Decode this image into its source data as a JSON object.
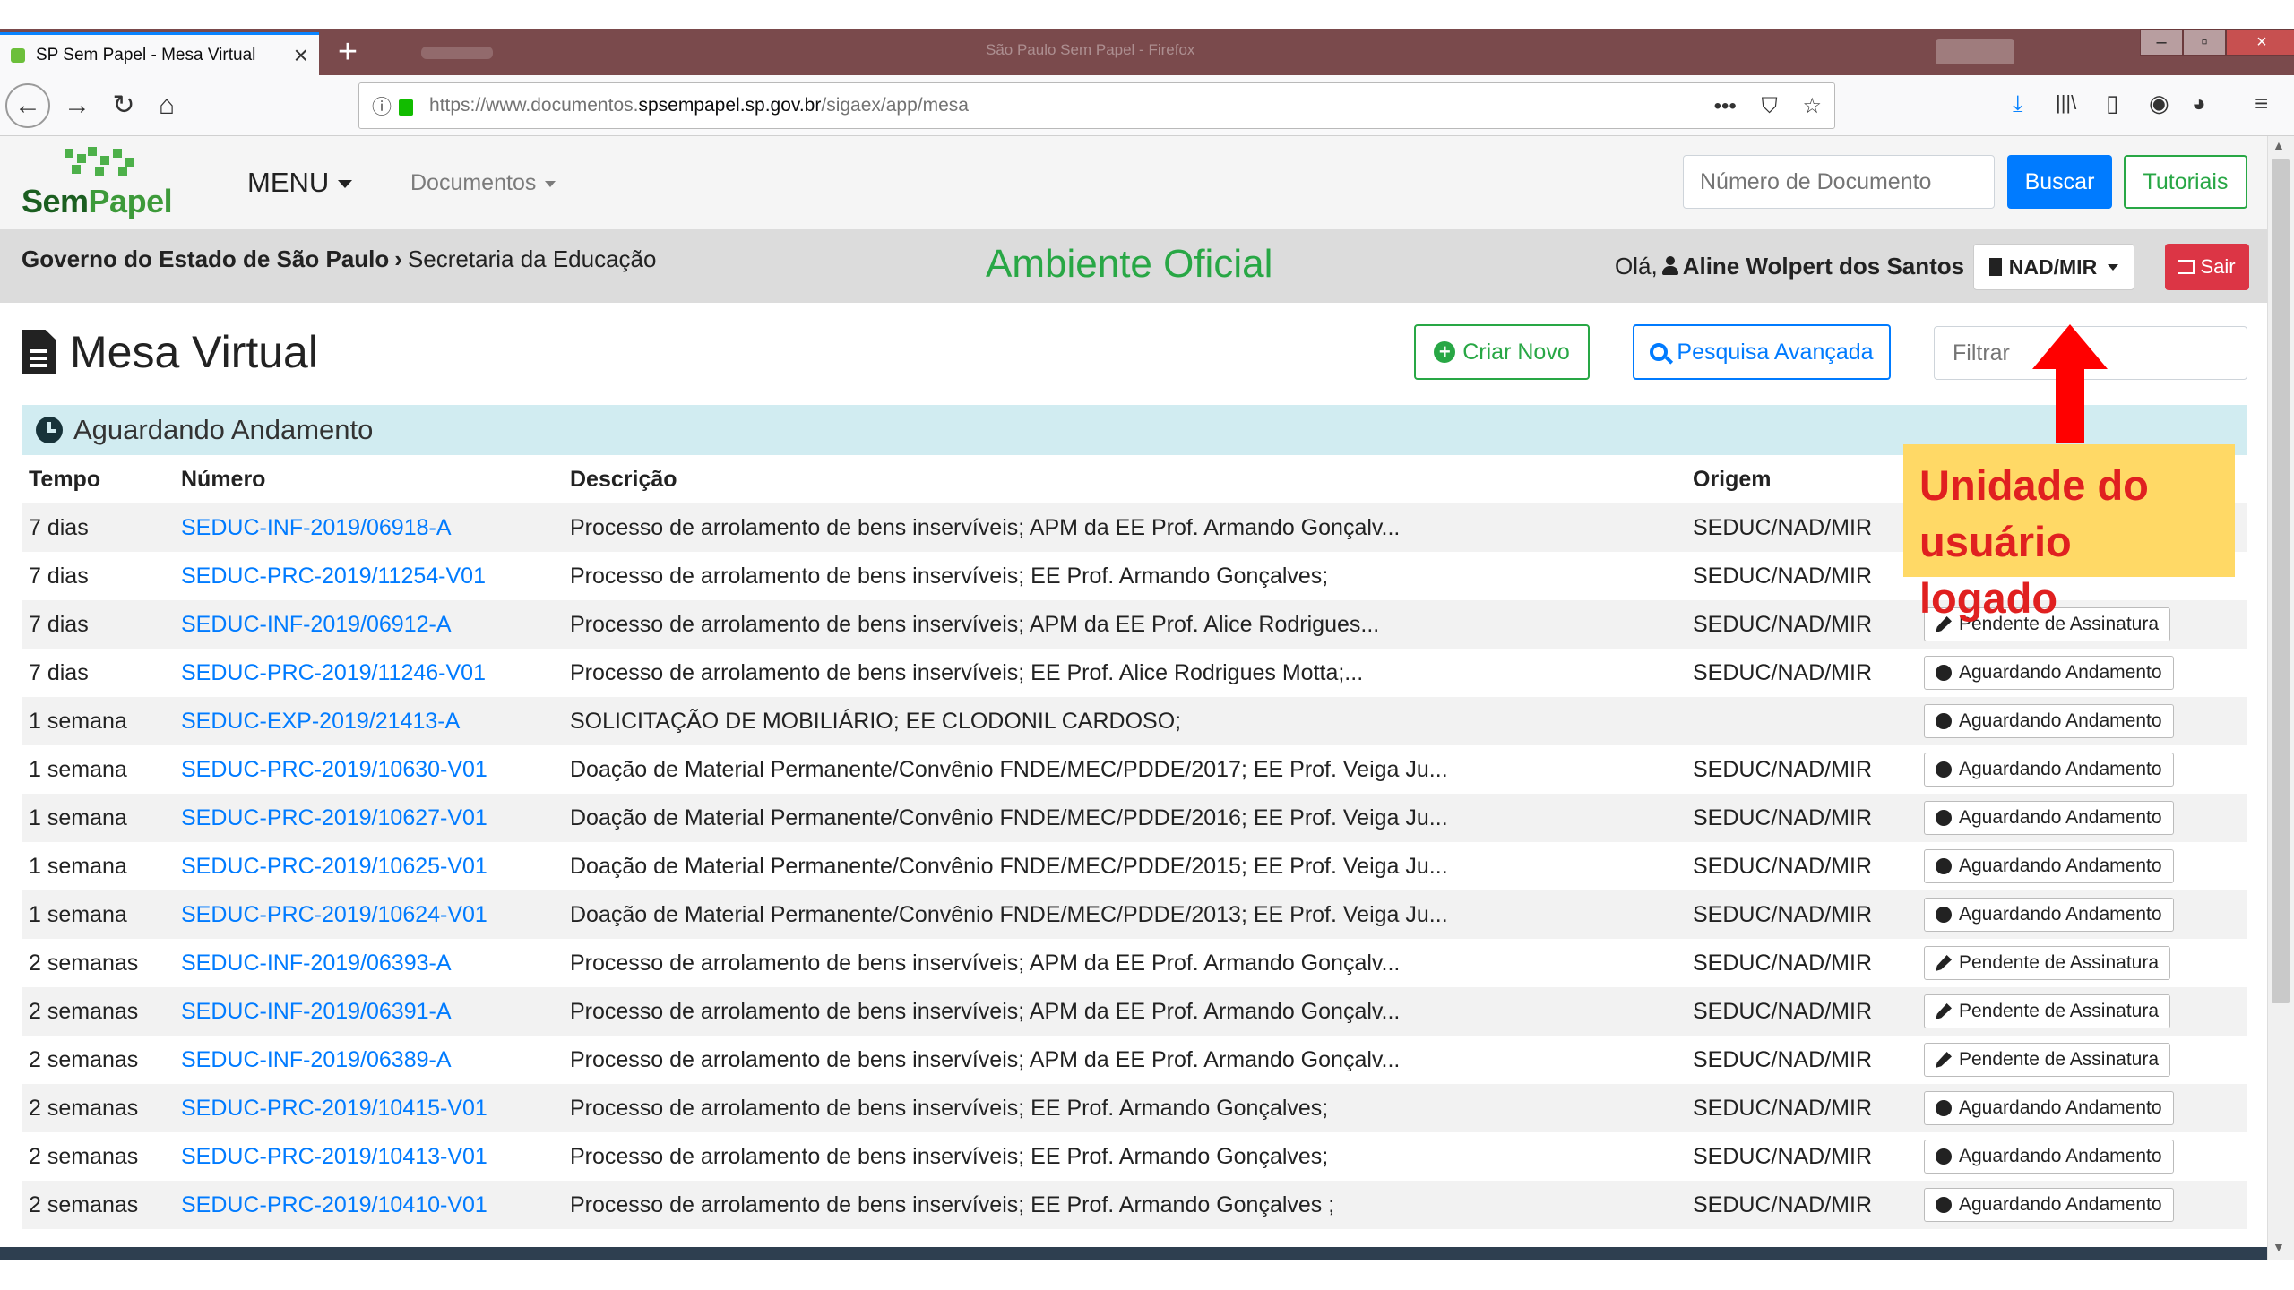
{
  "browser": {
    "tab_title": "SP Sem Papel - Mesa Virtual",
    "tab_close": "×",
    "new_tab": "+",
    "window_title": "São Paulo Sem Papel - Firefox",
    "url_plain_prefix": "https://www.documentos.",
    "url_domain": "spsempapel.sp.gov.br",
    "url_path": "/sigaex/app/mesa",
    "url_more": "•••",
    "nav": {
      "back": "←",
      "forward": "→",
      "reload": "↻",
      "home": "⌂"
    },
    "toolbar": {
      "download": "⤓",
      "library": "|||\\",
      "sidebar": "▯",
      "account": "◉",
      "menu": "≡"
    }
  },
  "header": {
    "logo": {
      "sem": "Sem",
      "papel": "Papel"
    },
    "menu_label": "MENU",
    "documents_label": "Documentos",
    "doc_number_placeholder": "Número de Documento",
    "search_button": "Buscar",
    "tutorials_button": "Tutoriais"
  },
  "statusbar": {
    "breadcrumb_root": "Governo do Estado de São Paulo",
    "breadcrumb_sep": "›",
    "breadcrumb_child": "Secretaria da Educação",
    "environment": "Ambiente Oficial",
    "greeting": "Olá,",
    "user_name": "Aline Wolpert dos Santos",
    "unit": "NAD/MIR",
    "logout": "Sair"
  },
  "main": {
    "page_title": "Mesa Virtual",
    "create_button": "Criar Novo",
    "advanced_search_button": "Pesquisa Avançada",
    "filter_placeholder": "Filtrar",
    "group_title": "Aguardando Andamento",
    "columns": {
      "time": "Tempo",
      "number": "Número",
      "description": "Descrição",
      "origin": "Origem"
    },
    "rows": [
      {
        "time": "7 dias",
        "number": "SEDUC-INF-2019/06918-A",
        "description": "Processo de arrolamento de bens inservíveis; APM da EE Prof. Armando Gonçalv...",
        "origin": "SEDUC/NAD/MIR",
        "status": "",
        "status_icon": ""
      },
      {
        "time": "7 dias",
        "number": "SEDUC-PRC-2019/11254-V01",
        "description": "Processo de arrolamento de bens inservíveis; EE Prof. Armando Gonçalves;",
        "origin": "SEDUC/NAD/MIR",
        "status": "",
        "status_icon": ""
      },
      {
        "time": "7 dias",
        "number": "SEDUC-INF-2019/06912-A",
        "description": "Processo de arrolamento de bens inservíveis; APM da EE Prof. Alice Rodrigues...",
        "origin": "SEDUC/NAD/MIR",
        "status": "Pendente de Assinatura",
        "status_icon": "pen-icon"
      },
      {
        "time": "7 dias",
        "number": "SEDUC-PRC-2019/11246-V01",
        "description": "Processo de arrolamento de bens inservíveis; EE Prof. Alice Rodrigues Motta;...",
        "origin": "SEDUC/NAD/MIR",
        "status": "Aguardando Andamento",
        "status_icon": "clock-icon"
      },
      {
        "time": "1 semana",
        "number": "SEDUC-EXP-2019/21413-A",
        "description": "SOLICITAÇÃO DE MOBILIÁRIO; EE CLODONIL CARDOSO;",
        "origin": "",
        "status": "Aguardando Andamento",
        "status_icon": "clock-icon"
      },
      {
        "time": "1 semana",
        "number": "SEDUC-PRC-2019/10630-V01",
        "description": "Doação de Material Permanente/Convênio FNDE/MEC/PDDE/2017; EE Prof. Veiga Ju...",
        "origin": "SEDUC/NAD/MIR",
        "status": "Aguardando Andamento",
        "status_icon": "clock-icon"
      },
      {
        "time": "1 semana",
        "number": "SEDUC-PRC-2019/10627-V01",
        "description": "Doação de Material Permanente/Convênio FNDE/MEC/PDDE/2016; EE Prof. Veiga Ju...",
        "origin": "SEDUC/NAD/MIR",
        "status": "Aguardando Andamento",
        "status_icon": "clock-icon"
      },
      {
        "time": "1 semana",
        "number": "SEDUC-PRC-2019/10625-V01",
        "description": "Doação de Material Permanente/Convênio FNDE/MEC/PDDE/2015; EE Prof. Veiga Ju...",
        "origin": "SEDUC/NAD/MIR",
        "status": "Aguardando Andamento",
        "status_icon": "clock-icon"
      },
      {
        "time": "1 semana",
        "number": "SEDUC-PRC-2019/10624-V01",
        "description": "Doação de Material Permanente/Convênio FNDE/MEC/PDDE/2013; EE Prof. Veiga Ju...",
        "origin": "SEDUC/NAD/MIR",
        "status": "Aguardando Andamento",
        "status_icon": "clock-icon"
      },
      {
        "time": "2 semanas",
        "number": "SEDUC-INF-2019/06393-A",
        "description": "Processo de arrolamento de bens inservíveis; APM da EE Prof. Armando Gonçalv...",
        "origin": "SEDUC/NAD/MIR",
        "status": "Pendente de Assinatura",
        "status_icon": "pen-icon"
      },
      {
        "time": "2 semanas",
        "number": "SEDUC-INF-2019/06391-A",
        "description": "Processo de arrolamento de bens inservíveis; APM da EE Prof. Armando Gonçalv...",
        "origin": "SEDUC/NAD/MIR",
        "status": "Pendente de Assinatura",
        "status_icon": "pen-icon"
      },
      {
        "time": "2 semanas",
        "number": "SEDUC-INF-2019/06389-A",
        "description": "Processo de arrolamento de bens inservíveis; APM da EE Prof. Armando Gonçalv...",
        "origin": "SEDUC/NAD/MIR",
        "status": "Pendente de Assinatura",
        "status_icon": "pen-icon"
      },
      {
        "time": "2 semanas",
        "number": "SEDUC-PRC-2019/10415-V01",
        "description": "Processo de arrolamento de bens inservíveis; EE Prof. Armando Gonçalves;",
        "origin": "SEDUC/NAD/MIR",
        "status": "Aguardando Andamento",
        "status_icon": "clock-icon"
      },
      {
        "time": "2 semanas",
        "number": "SEDUC-PRC-2019/10413-V01",
        "description": "Processo de arrolamento de bens inservíveis; EE Prof. Armando Gonçalves;",
        "origin": "SEDUC/NAD/MIR",
        "status": "Aguardando Andamento",
        "status_icon": "clock-icon"
      },
      {
        "time": "2 semanas",
        "number": "SEDUC-PRC-2019/10410-V01",
        "description": "Processo de arrolamento de bens inservíveis; EE Prof. Armando Gonçalves ;",
        "origin": "SEDUC/NAD/MIR",
        "status": "Aguardando Andamento",
        "status_icon": "clock-icon"
      }
    ]
  },
  "annotation": {
    "callout_line1": "Unidade do",
    "callout_line2": "usuário logado",
    "arrow_color": "#ff0000",
    "callout_bg": "#ffd966"
  },
  "colors": {
    "brand_green": "#28a745",
    "primary_blue": "#007bff",
    "danger_red": "#dc3545",
    "group_header_bg": "#d1ecf1"
  }
}
